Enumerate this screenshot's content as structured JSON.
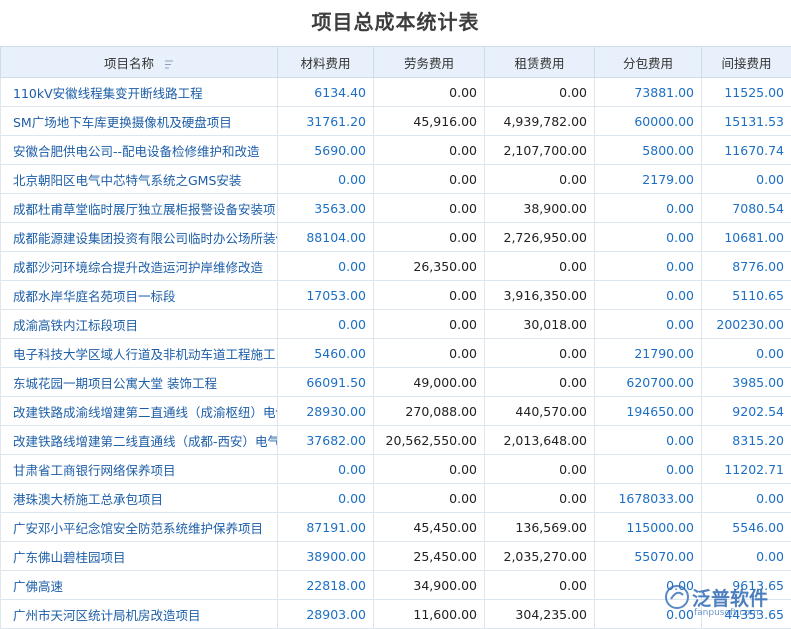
{
  "title": "项目总成本统计表",
  "columns": [
    "项目名称",
    "材料费用",
    "劳务费用",
    "租赁费用",
    "分包费用",
    "间接费用"
  ],
  "rows": [
    [
      "110kV安徽线程集变开断线路工程",
      "6134.40",
      "0.00",
      "0.00",
      "73881.00",
      "11525.00"
    ],
    [
      "SM广场地下车库更换摄像机及硬盘项目",
      "31761.20",
      "45,916.00",
      "4,939,782.00",
      "60000.00",
      "15131.53"
    ],
    [
      "安徽合肥供电公司--配电设备检修维护和改造",
      "5690.00",
      "0.00",
      "2,107,700.00",
      "5800.00",
      "11670.74"
    ],
    [
      "北京朝阳区电气中芯特气系统之GMS安装",
      "0.00",
      "0.00",
      "0.00",
      "2179.00",
      "0.00"
    ],
    [
      "成都杜甫草堂临时展厅独立展柜报警设备安装项目",
      "3563.00",
      "0.00",
      "38,900.00",
      "0.00",
      "7080.54"
    ],
    [
      "成都能源建设集团投资有限公司临时办公场所装修",
      "88104.00",
      "0.00",
      "2,726,950.00",
      "0.00",
      "10681.00"
    ],
    [
      "成都沙河环境综合提升改造运河护岸维修改造",
      "0.00",
      "26,350.00",
      "0.00",
      "0.00",
      "8776.00"
    ],
    [
      "成都水岸华庭名苑项目一标段",
      "17053.00",
      "0.00",
      "3,916,350.00",
      "0.00",
      "5110.65"
    ],
    [
      "成渝高铁内江标段项目",
      "0.00",
      "0.00",
      "30,018.00",
      "0.00",
      "200230.00"
    ],
    [
      "电子科技大学区域人行道及非机动车道工程施工",
      "5460.00",
      "0.00",
      "0.00",
      "21790.00",
      "0.00"
    ],
    [
      "东城花园一期项目公寓大堂 装饰工程",
      "66091.50",
      "49,000.00",
      "0.00",
      "620700.00",
      "3985.00"
    ],
    [
      "改建铁路成渝线增建第二直通线（成渝枢纽）电气化",
      "28930.00",
      "270,088.00",
      "440,570.00",
      "194650.00",
      "9202.54"
    ],
    [
      "改建铁路线增建第二线直通线（成都-西安）电气化",
      "37682.00",
      "20,562,550.00",
      "2,013,648.00",
      "0.00",
      "8315.20"
    ],
    [
      "甘肃省工商银行网络保养项目",
      "0.00",
      "0.00",
      "0.00",
      "0.00",
      "11202.71"
    ],
    [
      "港珠澳大桥施工总承包项目",
      "0.00",
      "0.00",
      "0.00",
      "1678033.00",
      "0.00"
    ],
    [
      "广安邓小平纪念馆安全防范系统维护保养项目",
      "87191.00",
      "45,450.00",
      "136,569.00",
      "115000.00",
      "5546.00"
    ],
    [
      "广东佛山碧桂园项目",
      "38900.00",
      "25,450.00",
      "2,035,270.00",
      "55070.00",
      "0.00"
    ],
    [
      "广佛高速",
      "22818.00",
      "34,900.00",
      "0.00",
      "0.00",
      "9613.65"
    ],
    [
      "广州市天河区统计局机房改造项目",
      "28903.00",
      "11,600.00",
      "304,235.00",
      "0.00",
      "44353.65"
    ]
  ],
  "logo": {
    "name": "泛普软件",
    "url": "fanpusoft.com"
  },
  "colors": {
    "header_bg": "#e8f1fb",
    "link": "#1c5ea8",
    "number_blue": "#1c6fc4"
  }
}
